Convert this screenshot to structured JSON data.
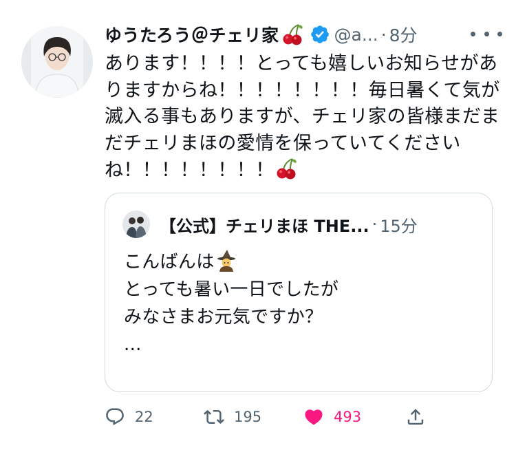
{
  "tweet": {
    "author_name": "ゆうたろう＠チェリ家",
    "handle": "@a...",
    "separator": "·",
    "time": "8分",
    "body": "あります！！！！とっても嬉しいお知らせがありますからね！！！！！！！！毎日暑くて気が滅入る事もありますが、チェリ家の皆様まだまだチェリまほの愛情を保っていてくださいね！！！！！！！！",
    "quote": {
      "author_name": "【公式】チェリまほ THE...",
      "separator": "·",
      "time": "15分",
      "text_line1": "こんばんは",
      "text_rest": "\nとっても暑い一日でしたが\nみなさまお元気ですか？\n..."
    },
    "actions": {
      "replies": "22",
      "retweets": "195",
      "likes": "493"
    }
  },
  "colors": {
    "secondary_text": "#536471",
    "verified_blue": "#1d9bf0",
    "like_pink": "#f91880",
    "border": "#cfd9de"
  },
  "icons": [
    "avatar",
    "cherry-emoji",
    "verified-badge-icon",
    "more-icon",
    "witch-emoji",
    "reply-icon",
    "retweet-icon",
    "like-icon",
    "share-icon"
  ]
}
